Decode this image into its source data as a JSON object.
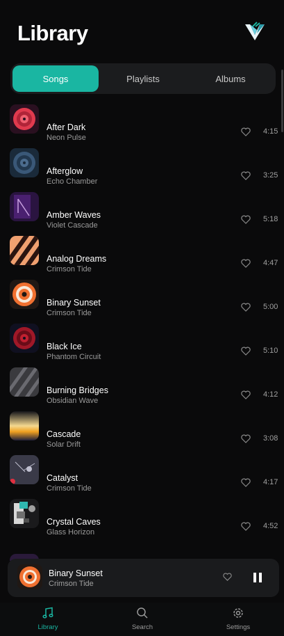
{
  "header": {
    "title": "Library",
    "logo_icon": "v-logo-icon"
  },
  "tabs": [
    {
      "label": "Songs",
      "active": true
    },
    {
      "label": "Playlists",
      "active": false
    },
    {
      "label": "Albums",
      "active": false
    }
  ],
  "songs": [
    {
      "title": "After Dark",
      "artist": "Neon Pulse",
      "duration": "4:15"
    },
    {
      "title": "Afterglow",
      "artist": "Echo Chamber",
      "duration": "3:25"
    },
    {
      "title": "Amber Waves",
      "artist": "Violet Cascade",
      "duration": "5:18"
    },
    {
      "title": "Analog Dreams",
      "artist": "Crimson Tide",
      "duration": "4:47"
    },
    {
      "title": "Binary Sunset",
      "artist": "Crimson Tide",
      "duration": "5:00"
    },
    {
      "title": "Black Ice",
      "artist": "Phantom Circuit",
      "duration": "5:10"
    },
    {
      "title": "Burning Bridges",
      "artist": "Obsidian Wave",
      "duration": "4:12"
    },
    {
      "title": "Cascade",
      "artist": "Solar Drift",
      "duration": "3:08"
    },
    {
      "title": "Catalyst",
      "artist": "Crimson Tide",
      "duration": "4:17"
    },
    {
      "title": "Crystal Caves",
      "artist": "Glass Horizon",
      "duration": "4:52"
    }
  ],
  "now_playing": {
    "title": "Binary Sunset",
    "artist": "Crimson Tide"
  },
  "nav": [
    {
      "label": "Library",
      "icon": "music-note-icon",
      "active": true
    },
    {
      "label": "Search",
      "icon": "search-icon",
      "active": false
    },
    {
      "label": "Settings",
      "icon": "gear-icon",
      "active": false
    }
  ],
  "colors": {
    "accent": "#1ab6a2",
    "background": "#0a0a0b",
    "surface": "#1b1c1e"
  }
}
